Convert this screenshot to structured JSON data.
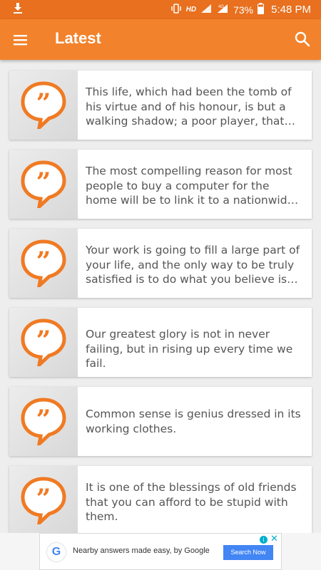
{
  "status_bar": {
    "network": "HD",
    "signal": "4G",
    "battery": "73%",
    "time": "5:48 PM"
  },
  "app_bar": {
    "title": "Latest",
    "menu_icon": "hamburger-menu-icon",
    "search_icon": "search-icon"
  },
  "colors": {
    "status_bar": "#e8701f",
    "app_bar": "#f2822b",
    "accent": "#f07a23"
  },
  "quotes": [
    {
      "text": "This life, which had been the tomb of his virtue and of his honour, is but a walking shadow; a poor player, that struts and frets his hour upon the stage",
      "icon": "quote-bubble-icon"
    },
    {
      "text": "The most compelling reason for most people to buy a computer for the home will be to link it to a nationwide communications network",
      "icon": "quote-bubble-icon"
    },
    {
      "text": "Your work is going to fill a large part of your life, and the only way to be truly satisfied is to do what you believe is great work",
      "icon": "quote-bubble-icon"
    },
    {
      "text": "Our greatest glory is not in never failing, but in rising up every time we fail.",
      "icon": "quote-bubble-icon"
    },
    {
      "text": "Common sense is genius dressed in its working clothes.",
      "icon": "quote-bubble-icon"
    },
    {
      "text": "It is one of the blessings of old friends that you can afford to be stupid with them.",
      "icon": "quote-bubble-icon"
    }
  ],
  "ad": {
    "logo": "G",
    "text": "Nearby answers made easy, by Google",
    "button": "Search Now",
    "info_icon": "i",
    "close_icon": "✕"
  }
}
